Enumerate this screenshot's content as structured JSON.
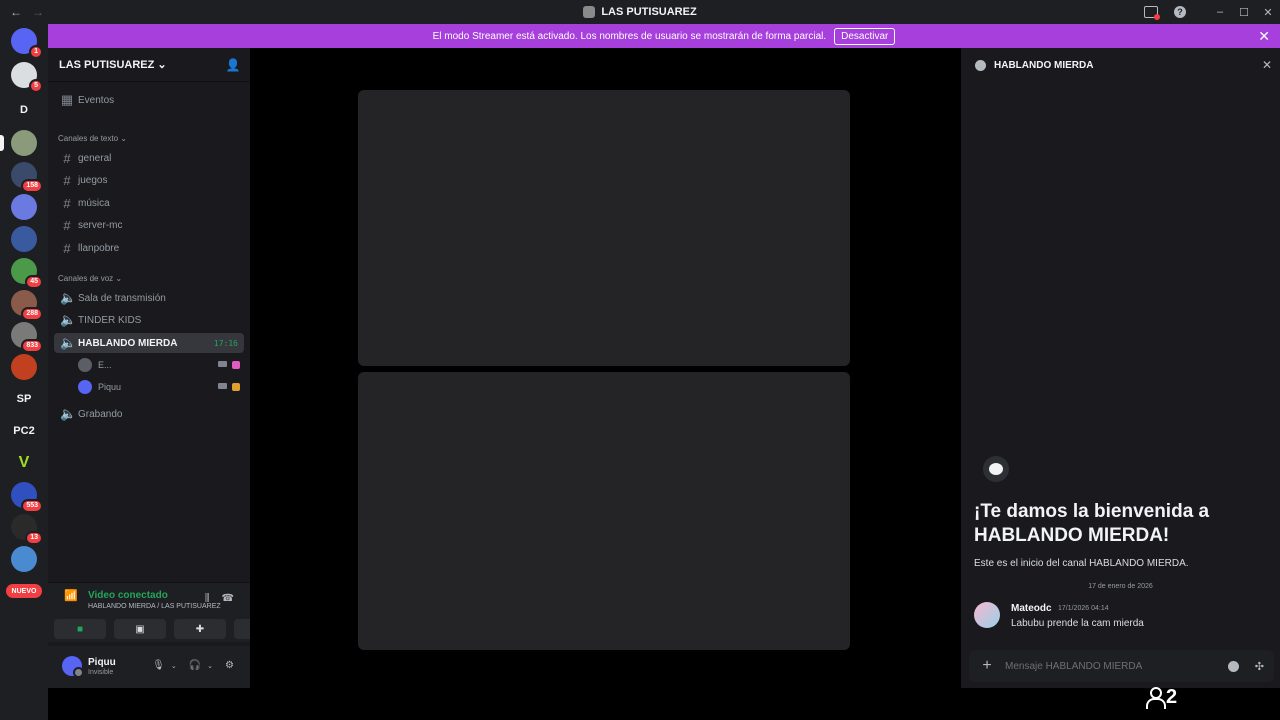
{
  "window": {
    "title": "LAS PUTISUAREZ",
    "back_glyph": "←",
    "forward_glyph": "→",
    "help_glyph": "?",
    "min_glyph": "–",
    "max_glyph": "☐",
    "close_glyph": "✕"
  },
  "streamer_bar": {
    "message": "El modo Streamer está activado. Los nombres de usuario se mostrarán de forma parcial.",
    "button": "Desactivar",
    "close_glyph": "✕"
  },
  "server_rail": {
    "servers": [
      {
        "label": "",
        "badge": "1",
        "color": "#5865f2"
      },
      {
        "label": "",
        "badge": "5",
        "color": "#dbdee1"
      },
      {
        "label": "D",
        "badge": "",
        "color": "#1e1f22"
      },
      {
        "label": "",
        "badge": "",
        "color": "#8a9a7a"
      },
      {
        "label": "",
        "badge": "158",
        "color": "#3a4a6a"
      },
      {
        "label": "",
        "badge": "",
        "color": "#6a7ae0"
      },
      {
        "label": "",
        "badge": "",
        "color": "#3a5aa0"
      },
      {
        "label": "",
        "badge": "45",
        "color": "#4a9a4a"
      },
      {
        "label": "",
        "badge": "288",
        "color": "#8a5a4a"
      },
      {
        "label": "",
        "badge": "833",
        "color": "#7a7a7a"
      },
      {
        "label": "",
        "badge": "",
        "color": "#c04020"
      },
      {
        "label": "SP",
        "badge": "",
        "color": "#1e1f22"
      },
      {
        "label": "PC2",
        "badge": "",
        "color": "#1e1f22"
      },
      {
        "label": "V",
        "badge": "",
        "color": "#1e1f22"
      },
      {
        "label": "",
        "badge": "553",
        "color": "#3050c0"
      },
      {
        "label": "",
        "badge": "13",
        "color": "#2a2a2a"
      },
      {
        "label": "",
        "badge": "",
        "color": "#4a8ad0"
      }
    ],
    "nuevo": "NUEVO"
  },
  "sidebar": {
    "guild_name": "LAS PUTISUAREZ",
    "events": "Eventos",
    "text_category": "Canales de texto",
    "text_channels": [
      "general",
      "juegos",
      "música",
      "server-mc",
      "llanpobre"
    ],
    "voice_category": "Canales de voz",
    "voice_channels": {
      "sala": "Sala de transmisión",
      "tinder": "TINDER KIDS",
      "hablando": "HABLANDO MIERDA",
      "grabando": "Grabando"
    },
    "timer": "17:16",
    "voice_users": [
      "E...",
      "Piquu"
    ]
  },
  "voice_panel": {
    "title": "Video conectado",
    "subtitle": "HABLANDO MIERDA / LAS PUTISUAREZ"
  },
  "user_panel": {
    "name": "Piquu",
    "status": "Invisible"
  },
  "chat": {
    "channel": "HABLANDO MIERDA",
    "welcome": "¡Te damos la bienvenida a HABLANDO MIERDA!",
    "welcome_sub": "Este es el inicio del canal HABLANDO MIERDA.",
    "date_divider": "17 de enero de 2026",
    "message": {
      "author": "Mateodc",
      "timestamp": "17/1/2026 04:14",
      "text": "Labubu prende la cam mierda"
    },
    "composer_placeholder": "Mensaje HABLANDO MIERDA"
  },
  "viewers": {
    "count": "2"
  },
  "colors": {
    "accent": "#a63fdb",
    "connected": "#23a55a",
    "badge": "#f23f43",
    "brand": "#5865f2"
  }
}
